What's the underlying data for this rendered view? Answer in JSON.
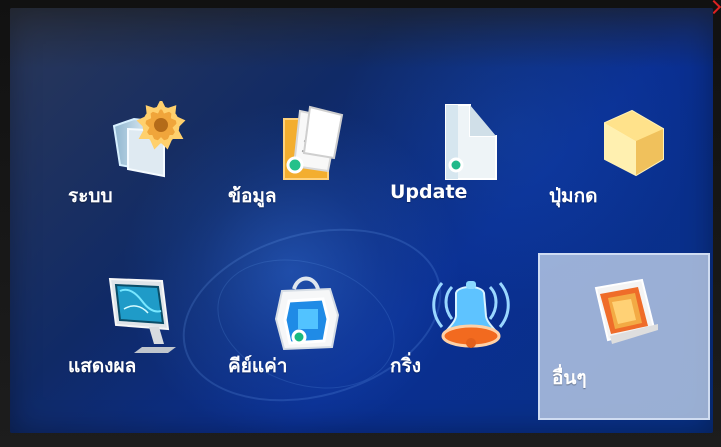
{
  "menu": {
    "items": [
      {
        "label": "ระบบ",
        "icon": "system-folder-gear-icon"
      },
      {
        "label": "ข้อมูล",
        "icon": "data-folder-documents-icon"
      },
      {
        "label": "Update",
        "icon": "update-document-icon"
      },
      {
        "label": "ปุ่มกด",
        "icon": "keypad-folder-icon"
      },
      {
        "label": "แสดงผล",
        "icon": "display-monitor-icon"
      },
      {
        "label": "คีย์แค่า",
        "icon": "tool-bag-icon"
      },
      {
        "label": "กริ่ง",
        "icon": "bell-icon"
      },
      {
        "label": "อื่นๆ",
        "icon": "misc-app-icon"
      }
    ],
    "selected_index": 7
  },
  "colors": {
    "background_start": "#2b3858",
    "background_mid": "#0a2f92",
    "selection": "#d7e0ec",
    "label": "#ffffff"
  }
}
